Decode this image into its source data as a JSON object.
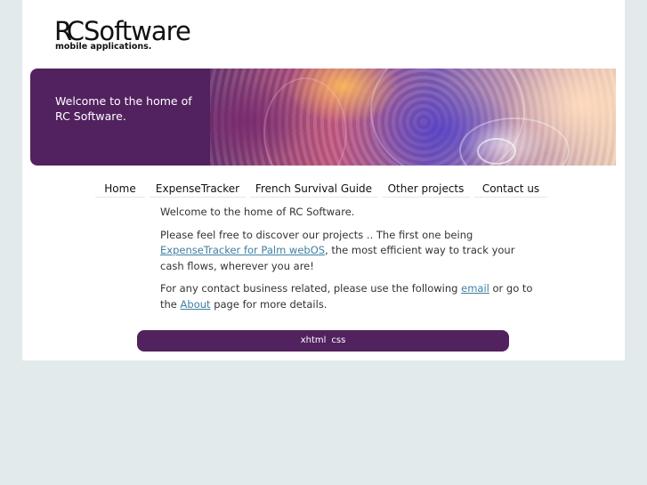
{
  "logo": {
    "rc": "RC",
    "name": "Software",
    "tagline": "mobile applications."
  },
  "banner": {
    "line1": "Welcome to the home of",
    "line2": "RC Software."
  },
  "nav": {
    "items": [
      {
        "label": "Home"
      },
      {
        "label": "ExpenseTracker"
      },
      {
        "label": "French Survival Guide"
      },
      {
        "label": "Other projects"
      },
      {
        "label": "Contact us"
      }
    ]
  },
  "content": {
    "intro": "Welcome to the home of RC Software.",
    "p2_before": "Please feel free to discover our projects .. The first one being ",
    "p2_link": "ExpenseTracker for Palm webOS",
    "p2_after": ", the most efficient way to track your cash flows, wherever you are!",
    "p3_before": "For any contact business related, please use the following ",
    "p3_link1": "email",
    "p3_mid": " or go to the ",
    "p3_link2": "About",
    "p3_after": " page for more details."
  },
  "footer": {
    "xhtml": "xhtml",
    "css": "css"
  },
  "colors": {
    "accent": "#52225f",
    "link": "#3f7fa0",
    "background": "#e3eaec"
  }
}
